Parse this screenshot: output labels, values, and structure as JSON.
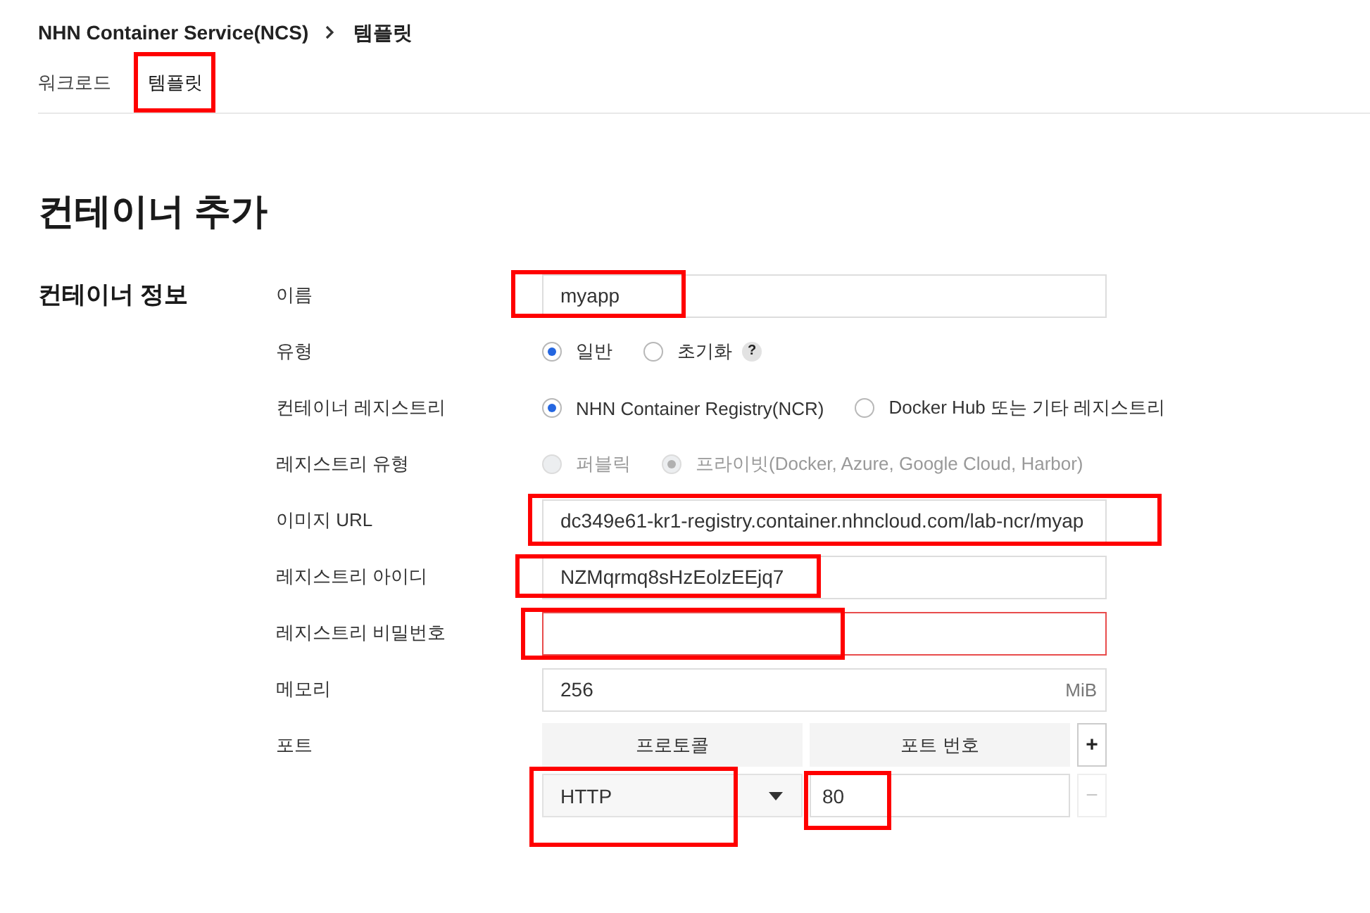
{
  "breadcrumb": [
    {
      "label": "NHN Container Service(NCS)"
    },
    {
      "label": "템플릿"
    }
  ],
  "tabs": [
    {
      "label": "워크로드",
      "selected": false,
      "highlighted": false
    },
    {
      "label": "템플릿",
      "selected": true,
      "highlighted": true
    }
  ],
  "page_title": "컨테이너 추가",
  "section": {
    "title": "컨테이너 정보",
    "fields": [
      {
        "label": "이름",
        "kind": "text",
        "value": "myapp",
        "invalid": false,
        "disabled": false,
        "highlighted": true
      },
      {
        "label": "유형",
        "kind": "radio",
        "disabled": false,
        "options": [
          {
            "label": "일반",
            "selected": true
          },
          {
            "label": "초기화",
            "selected": false,
            "help": "?"
          }
        ]
      },
      {
        "label": "컨테이너 레지스트리",
        "kind": "radio",
        "disabled": false,
        "options": [
          {
            "label": "NHN Container Registry(NCR)",
            "selected": true
          },
          {
            "label": "Docker Hub 또는 기타 레지스트리",
            "selected": false
          }
        ]
      },
      {
        "label": "레지스트리 유형",
        "kind": "radio",
        "disabled": true,
        "options": [
          {
            "label": "퍼블릭",
            "selected": false
          },
          {
            "label": "프라이빗(Docker, Azure, Google Cloud, Harbor)",
            "selected": true
          }
        ]
      },
      {
        "label": "이미지 URL",
        "kind": "text",
        "value": "dc349e61-kr1-registry.container.nhncloud.com/lab-ncr/myap",
        "invalid": false,
        "disabled": false,
        "highlighted": true
      },
      {
        "label": "레지스트리 아이디",
        "kind": "text",
        "value": "NZMqrmq8sHzEolzEEjq7",
        "invalid": false,
        "disabled": false,
        "highlighted": true
      },
      {
        "label": "레지스트리 비밀번호",
        "kind": "text",
        "invalid": true,
        "disabled": false,
        "highlighted": true
      },
      {
        "label": "메모리",
        "kind": "text",
        "value": "256",
        "unit": "MiB",
        "invalid": false,
        "disabled": false,
        "highlighted": false
      },
      {
        "label": "포트",
        "kind": "ports",
        "columns": [
          "프로토콜",
          "포트 번호"
        ],
        "add_button": "+",
        "rows": [
          {
            "protocol": "HTTP",
            "port": "80",
            "remove_button": "−",
            "remove_disabled": true,
            "protocol_highlighted": true,
            "port_highlighted": true
          }
        ]
      }
    ]
  }
}
